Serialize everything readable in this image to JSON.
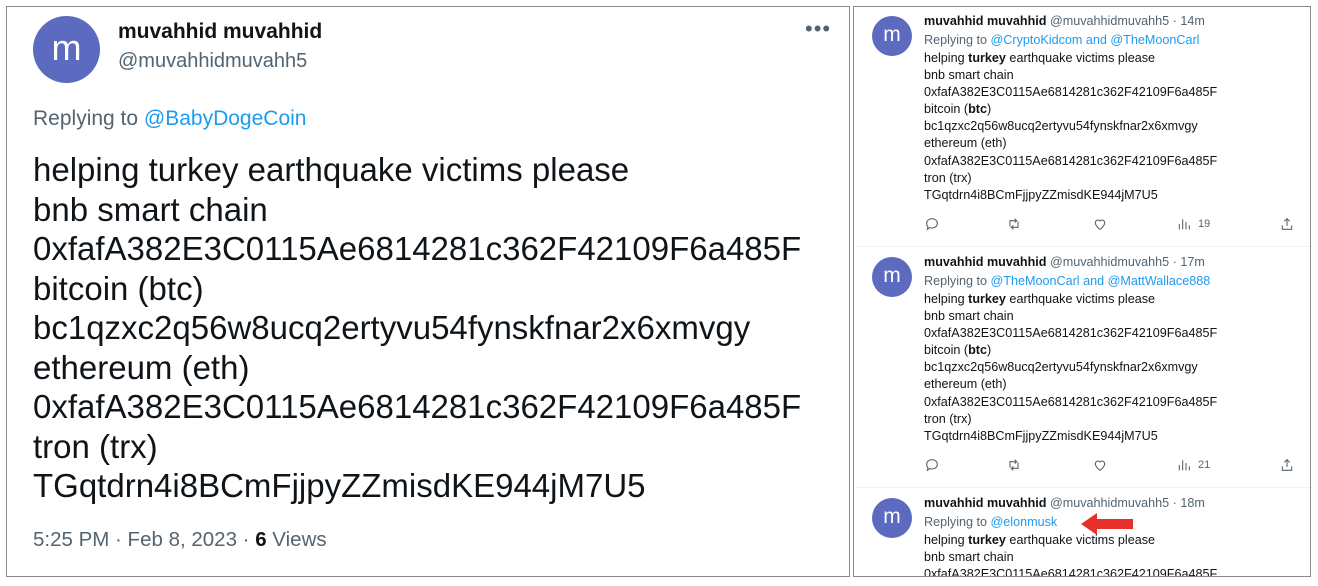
{
  "main_tweet": {
    "avatar_letter": "m",
    "name": "muvahhid muvahhid",
    "handle": "@muvahhidmuvahh5",
    "more_label": "•••",
    "replying_prefix": "Replying to ",
    "replying_to": "@BabyDogeCoin",
    "body": "helping turkey earthquake victims please\nbnb smart chain\n0xfafA382E3C0115Ae6814281c362F42109F6a485F\nbitcoin (btc)\nbc1qzxc2q56w8ucq2ertyvu54fynskfnar2x6xmvgy\nethereum (eth)\n0xfafA382E3C0115Ae6814281c362F42109F6a485F\ntron (trx)\nTGqtdrn4i8BCmFjjpyZZmisdKE944jM7U5",
    "time_date": "5:25 PM · Feb 8, 2023 · ",
    "views_count": "6",
    "views_label": " Views"
  },
  "replies": [
    {
      "avatar_letter": "m",
      "name": "muvahhid muvahhid",
      "meta": " @muvahhidmuvahh5 · 14m",
      "replying_prefix": "Replying to ",
      "replying_to": "@CryptoKidcom and @TheMoonCarl",
      "body_1": "helping ",
      "body_bold_1": "turkey",
      "body_2": " earthquake victims please\nbnb smart chain\n0xfafA382E3C0115Ae6814281c362F42109F6a485F\nbitcoin (",
      "body_bold_2": "btc",
      "body_3": ")\nbc1qzxc2q56w8ucq2ertyvu54fynskfnar2x6xmvgy\nethereum (eth)\n0xfafA382E3C0115Ae6814281c362F42109F6a485F\ntron (trx)\nTGqtdrn4i8BCmFjjpyZZmisdKE944jM7U5",
      "views": "19"
    },
    {
      "avatar_letter": "m",
      "name": "muvahhid muvahhid",
      "meta": " @muvahhidmuvahh5 · 17m",
      "replying_prefix": "Replying to ",
      "replying_to": "@TheMoonCarl and @MattWallace888",
      "body_1": "helping ",
      "body_bold_1": "turkey",
      "body_2": " earthquake victims please\nbnb smart chain\n0xfafA382E3C0115Ae6814281c362F42109F6a485F\nbitcoin (",
      "body_bold_2": "btc",
      "body_3": ")\nbc1qzxc2q56w8ucq2ertyvu54fynskfnar2x6xmvgy\nethereum (eth)\n0xfafA382E3C0115Ae6814281c362F42109F6a485F\ntron (trx)\nTGqtdrn4i8BCmFjjpyZZmisdKE944jM7U5",
      "views": "21"
    },
    {
      "avatar_letter": "m",
      "name": "muvahhid muvahhid",
      "meta": " @muvahhidmuvahh5 · 18m",
      "replying_prefix": "Replying to ",
      "replying_to": "@elonmusk",
      "body_1": "helping ",
      "body_bold_1": "turkey",
      "body_2": " earthquake victims please\nbnb smart chain\n0xfafA382E3C0115Ae6814281c362F42109F6a485F"
    }
  ],
  "icons": {
    "reply": "reply-icon",
    "retweet": "retweet-icon",
    "like": "like-icon",
    "views": "views-icon",
    "share": "share-icon",
    "annotation": "red-arrow-icon"
  },
  "colors": {
    "accent": "#1d9bf0",
    "avatar": "#5c6bc0",
    "secondary_text": "#536471",
    "arrow": "#e8302a"
  }
}
